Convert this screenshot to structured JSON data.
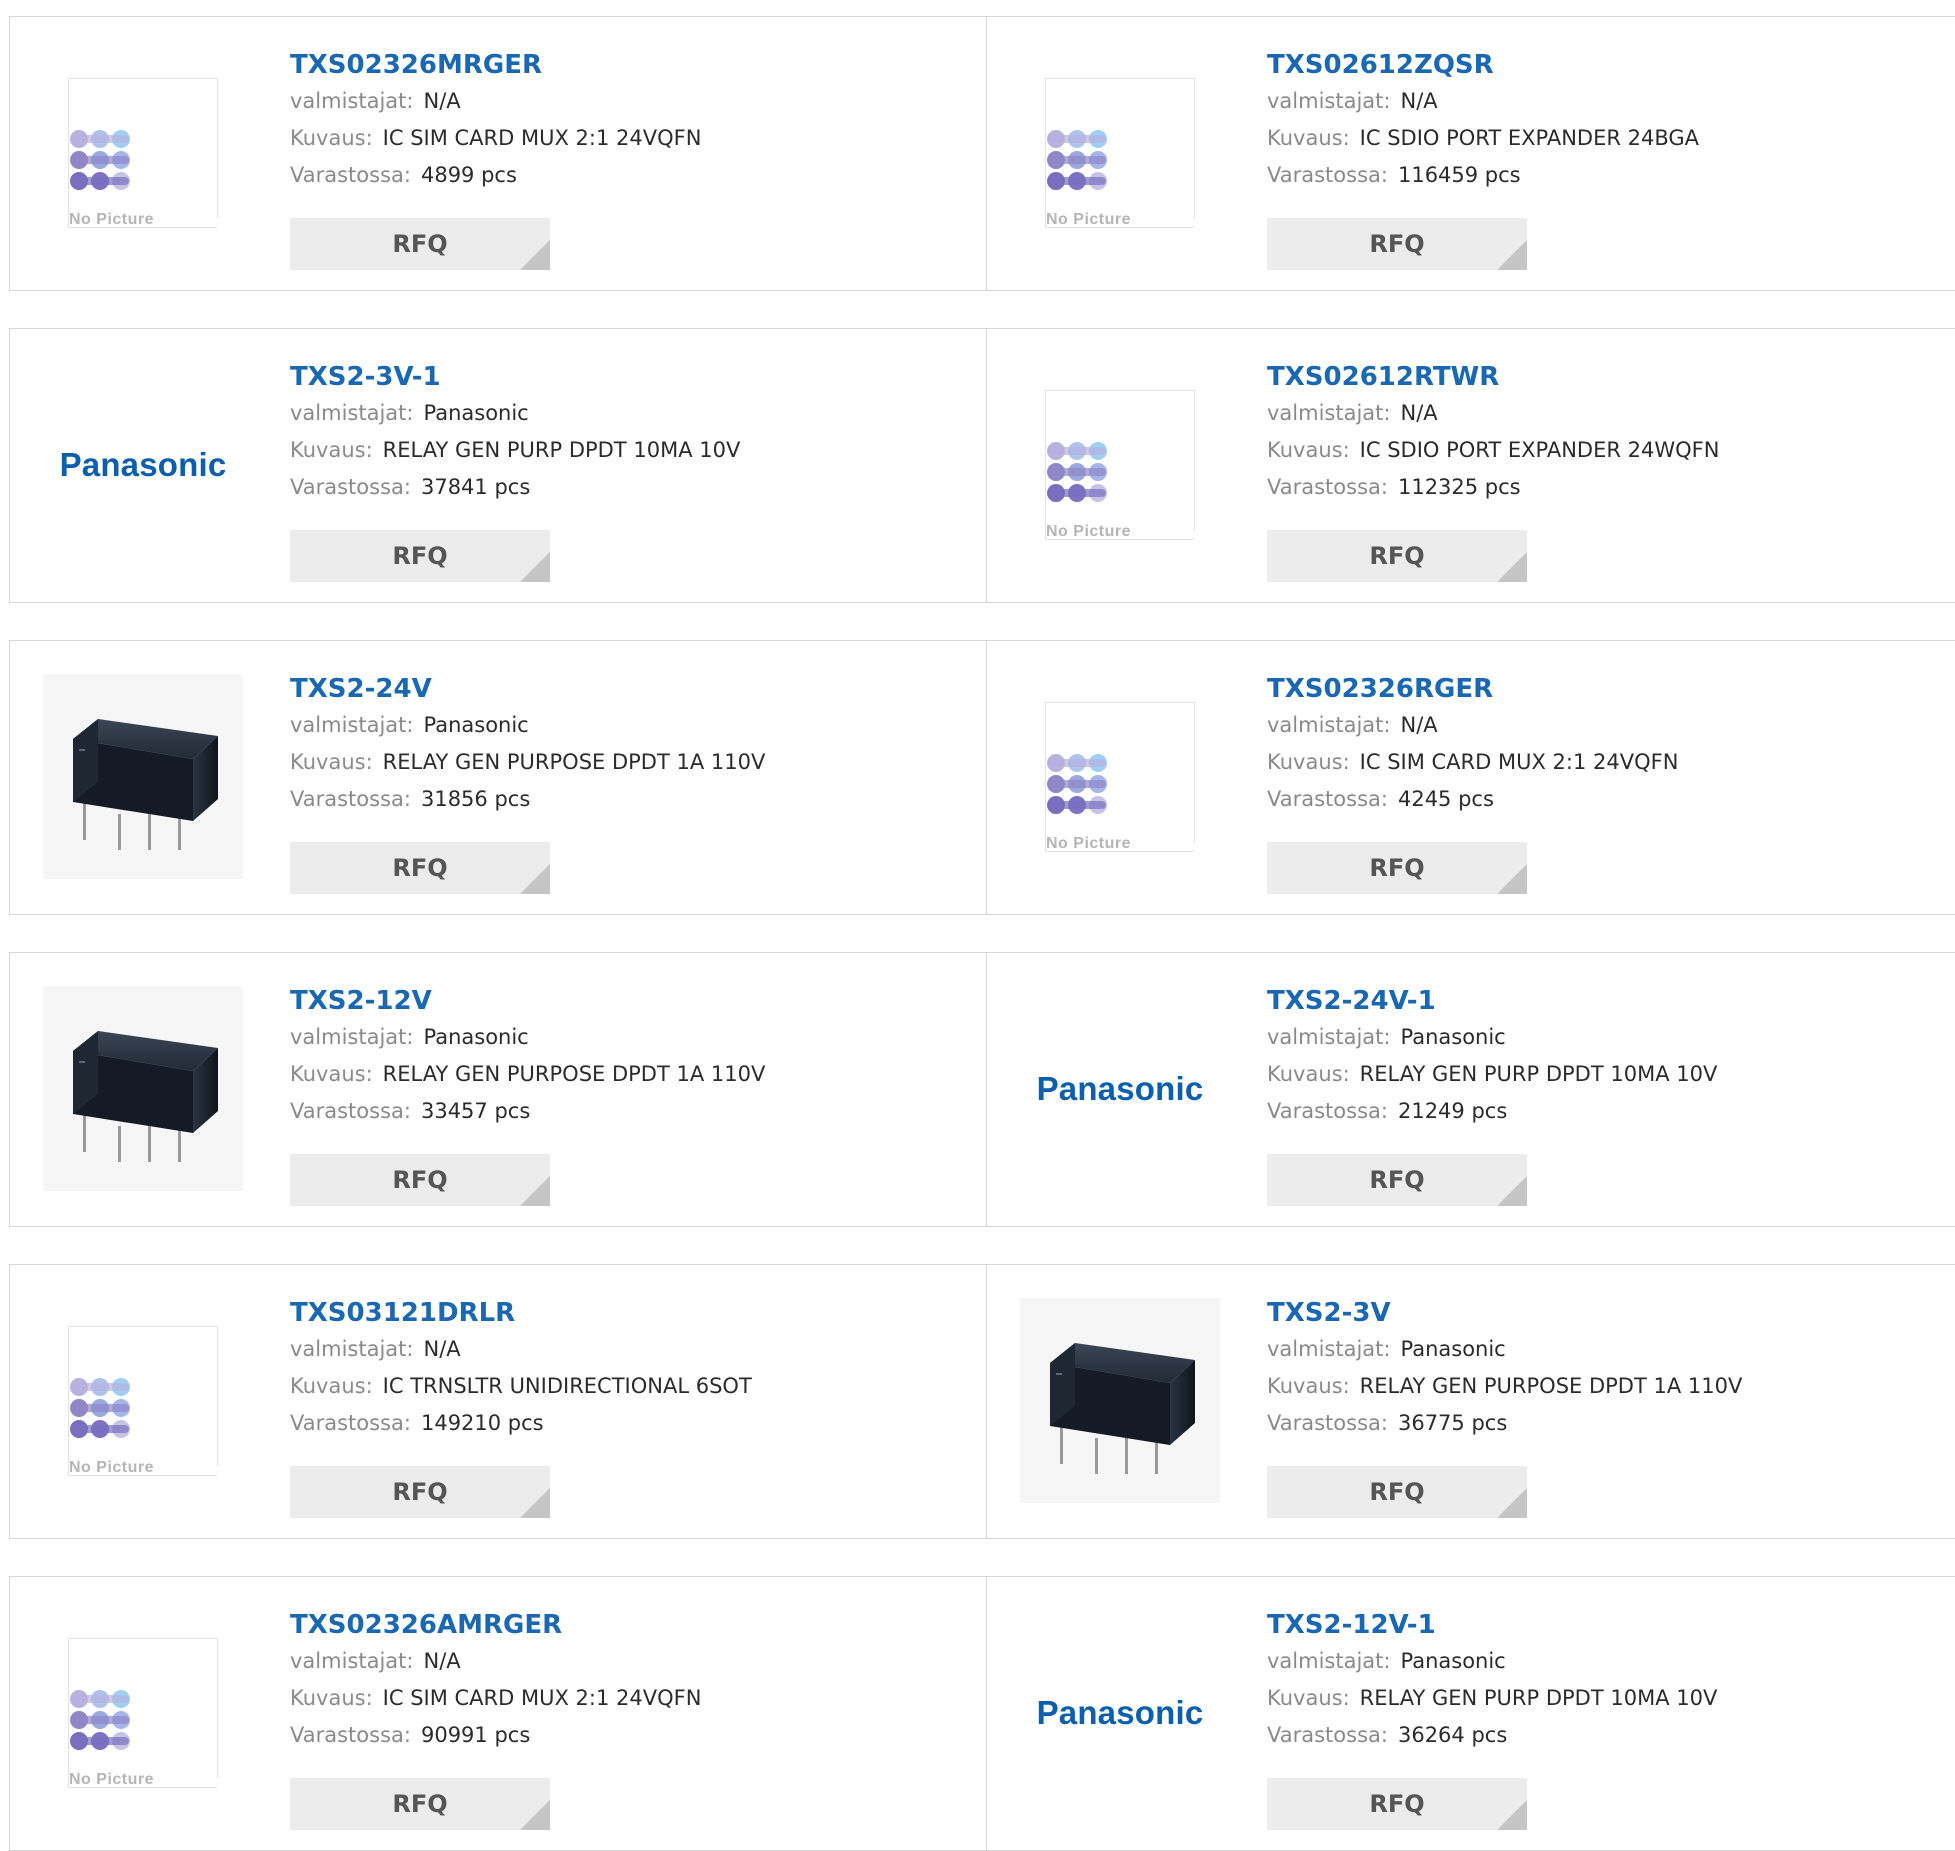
{
  "labels": {
    "manufacturer": "valmistajat:",
    "description": "Kuvaus:",
    "stock": "Varastossa:",
    "rfq": "RFQ",
    "no_picture": "No Picture",
    "brand_logo_text": "Panasonic"
  },
  "products": [
    {
      "pn": "TXS02326MRGER",
      "manufacturer": "N/A",
      "description": "IC SIM CARD MUX 2:1 24VQFN",
      "stock": "4899 pcs",
      "image": "nopicture"
    },
    {
      "pn": "TXS02612ZQSR",
      "manufacturer": "N/A",
      "description": "IC SDIO PORT EXPANDER 24BGA",
      "stock": "116459 pcs",
      "image": "nopicture"
    },
    {
      "pn": "TXS2-3V-1",
      "manufacturer": "Panasonic",
      "description": "RELAY GEN PURP DPDT 10MA 10V",
      "stock": "37841 pcs",
      "image": "logo"
    },
    {
      "pn": "TXS02612RTWR",
      "manufacturer": "N/A",
      "description": "IC SDIO PORT EXPANDER 24WQFN",
      "stock": "112325 pcs",
      "image": "nopicture"
    },
    {
      "pn": "TXS2-24V",
      "manufacturer": "Panasonic",
      "description": "RELAY GEN PURPOSE DPDT 1A 110V",
      "stock": "31856 pcs",
      "image": "relay"
    },
    {
      "pn": "TXS02326RGER",
      "manufacturer": "N/A",
      "description": "IC SIM CARD MUX 2:1 24VQFN",
      "stock": "4245 pcs",
      "image": "nopicture"
    },
    {
      "pn": "TXS2-12V",
      "manufacturer": "Panasonic",
      "description": "RELAY GEN PURPOSE DPDT 1A 110V",
      "stock": "33457 pcs",
      "image": "relay"
    },
    {
      "pn": "TXS2-24V-1",
      "manufacturer": "Panasonic",
      "description": "RELAY GEN PURP DPDT 10MA 10V",
      "stock": "21249 pcs",
      "image": "logo"
    },
    {
      "pn": "TXS03121DRLR",
      "manufacturer": "N/A",
      "description": "IC TRNSLTR UNIDIRECTIONAL 6SOT",
      "stock": "149210 pcs",
      "image": "nopicture"
    },
    {
      "pn": "TXS2-3V",
      "manufacturer": "Panasonic",
      "description": "RELAY GEN PURPOSE DPDT 1A 110V",
      "stock": "36775 pcs",
      "image": "relay"
    },
    {
      "pn": "TXS02326AMRGER",
      "manufacturer": "N/A",
      "description": "IC SIM CARD MUX 2:1 24VQFN",
      "stock": "90991 pcs",
      "image": "nopicture"
    },
    {
      "pn": "TXS2-12V-1",
      "manufacturer": "Panasonic",
      "description": "RELAY GEN PURP DPDT 10MA 10V",
      "stock": "36264 pcs",
      "image": "logo"
    }
  ],
  "colors": {
    "part_number": "#1a67b3",
    "brand_logo": "#0b5fae",
    "rfq_bg": "#ececec",
    "label": "#8a8a8a"
  }
}
